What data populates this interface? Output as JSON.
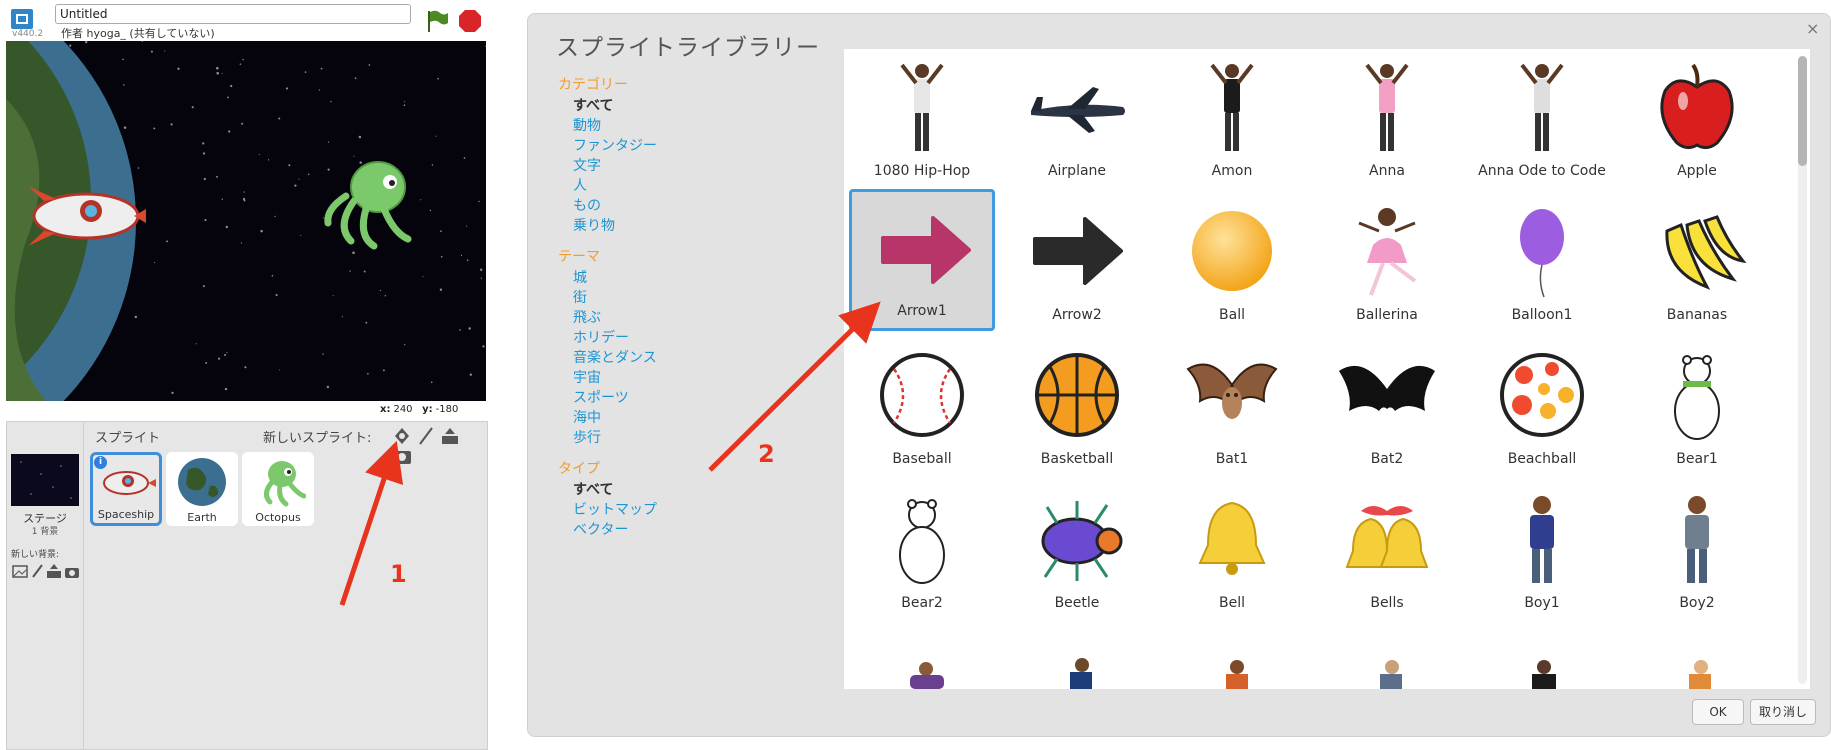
{
  "editor": {
    "version": "v440.2",
    "project_title": "Untitled",
    "author_line": "作者 hyoga_ (共有していない)",
    "coords": {
      "x_label": "x:",
      "x_value": "240",
      "y_label": "y:",
      "y_value": "-180"
    }
  },
  "sprite_pane": {
    "header": "スプライト",
    "new_sprite_label": "新しいスプライト:",
    "stage_label": "ステージ",
    "stage_bg_count": "1 背景",
    "new_bg_label": "新しい背景:",
    "info_badge": "i",
    "sprites": [
      {
        "name": "Spaceship",
        "icon": "spaceship-icon",
        "selected": true
      },
      {
        "name": "Earth",
        "icon": "earth-icon",
        "selected": false
      },
      {
        "name": "Octopus",
        "icon": "octopus-icon",
        "selected": false
      }
    ]
  },
  "library": {
    "title": "スプライトライブラリー",
    "close": "×",
    "category_header": "カテゴリー",
    "categories": [
      "すべて",
      "動物",
      "ファンタジー",
      "文字",
      "人",
      "もの",
      "乗り物"
    ],
    "theme_header": "テーマ",
    "themes": [
      "城",
      "街",
      "飛ぶ",
      "ホリデー",
      "音楽とダンス",
      "宇宙",
      "スポーツ",
      "海中",
      "歩行"
    ],
    "type_header": "タイプ",
    "types": [
      "すべて",
      "ビットマップ",
      "ベクター"
    ],
    "items": [
      {
        "name": "1080 Hip-Hop",
        "icon": "dancer-icon"
      },
      {
        "name": "Airplane",
        "icon": "airplane-icon"
      },
      {
        "name": "Amon",
        "icon": "dancer-icon"
      },
      {
        "name": "Anna",
        "icon": "dancer-icon"
      },
      {
        "name": "Anna Ode to Code",
        "icon": "dancer-icon"
      },
      {
        "name": "Apple",
        "icon": "apple-icon"
      },
      {
        "name": "Arrow1",
        "icon": "arrow-icon",
        "selected": true
      },
      {
        "name": "Arrow2",
        "icon": "arrow-icon"
      },
      {
        "name": "Ball",
        "icon": "ball-icon"
      },
      {
        "name": "Ballerina",
        "icon": "ballerina-icon"
      },
      {
        "name": "Balloon1",
        "icon": "balloon-icon"
      },
      {
        "name": "Bananas",
        "icon": "bananas-icon"
      },
      {
        "name": "Baseball",
        "icon": "baseball-icon"
      },
      {
        "name": "Basketball",
        "icon": "basketball-icon"
      },
      {
        "name": "Bat1",
        "icon": "bat-icon"
      },
      {
        "name": "Bat2",
        "icon": "bat-icon"
      },
      {
        "name": "Beachball",
        "icon": "beachball-icon"
      },
      {
        "name": "Bear1",
        "icon": "bear-icon"
      },
      {
        "name": "Bear2",
        "icon": "bear-icon"
      },
      {
        "name": "Beetle",
        "icon": "beetle-icon"
      },
      {
        "name": "Bell",
        "icon": "bell-icon"
      },
      {
        "name": "Bells",
        "icon": "bells-icon"
      },
      {
        "name": "Boy1",
        "icon": "boy-icon"
      },
      {
        "name": "Boy2",
        "icon": "boy-icon"
      }
    ],
    "ok_label": "OK",
    "cancel_label": "取り消し"
  },
  "annotations": {
    "step1": "1",
    "step2": "2"
  },
  "colors": {
    "accent_blue": "#3f9be0",
    "section_orange": "#f29b2f",
    "link_blue": "#1e95d3",
    "annotation_red": "#e8331d"
  }
}
